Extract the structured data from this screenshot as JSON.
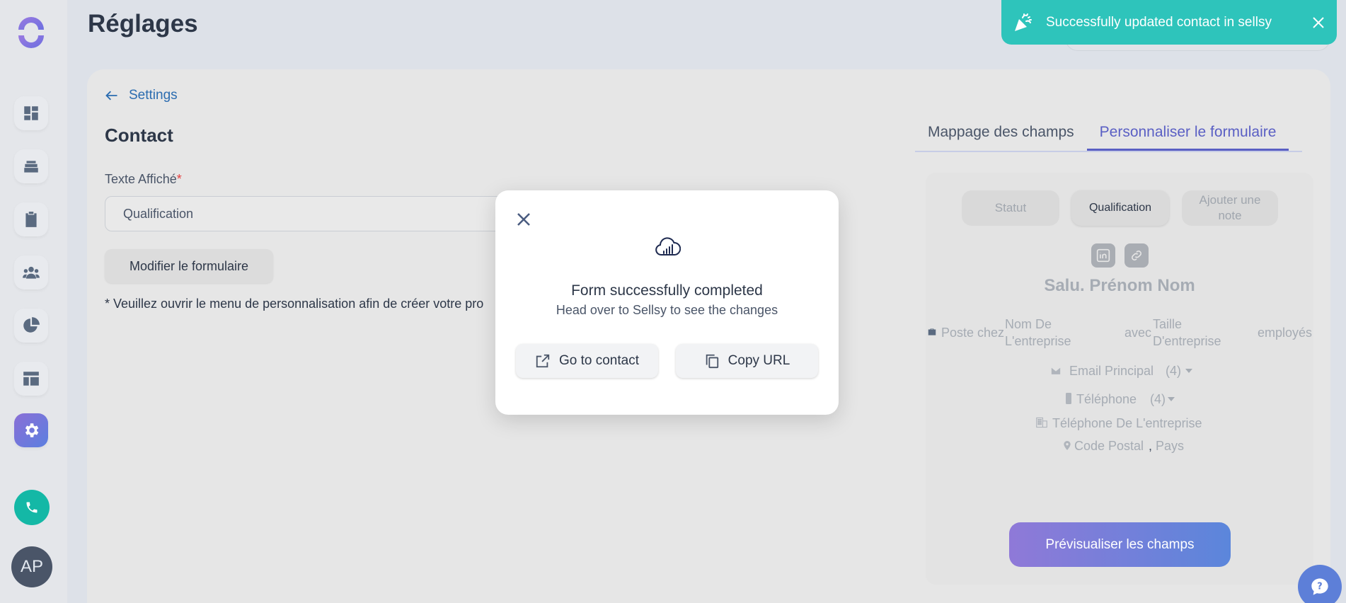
{
  "page": {
    "title": "Réglages"
  },
  "sidebar": {
    "items": [
      {
        "icon": "dashboard-icon"
      },
      {
        "icon": "stack-icon"
      },
      {
        "icon": "clipboard-icon"
      },
      {
        "icon": "users-icon"
      },
      {
        "icon": "pie-chart-icon"
      },
      {
        "icon": "layout-icon"
      },
      {
        "icon": "gear-icon",
        "active": true
      }
    ],
    "avatar_initials": "AP"
  },
  "breadcrumb": {
    "back_label": "Settings"
  },
  "form": {
    "section_title": "Contact",
    "field_label": "Texte Affiché",
    "required_mark": "*",
    "field_value": "Qualification",
    "modify_button": "Modifier le formulaire",
    "helper_text": "* Veuillez ouvrir le menu de personnalisation afin de créer votre pro"
  },
  "tabs": [
    {
      "label": "Mappage des champs",
      "active": false
    },
    {
      "label": "Personnaliser le formulaire",
      "active": true
    }
  ],
  "preview": {
    "pills": [
      "Statut",
      "Qualification",
      "Ajouter une note"
    ],
    "name": "Salu. Prénom Nom",
    "job_line": {
      "poste": "Poste chez",
      "company": "Nom De L'entreprise",
      "with": "avec",
      "size": "Taille D'entreprise",
      "employees": "employés"
    },
    "email": "Email Principal",
    "email_count": "(4)",
    "phone": "Téléphone",
    "phone_count": "(4)",
    "company_phone": "Téléphone De L'entreprise",
    "postal": "Code Postal",
    "comma": ",",
    "country": "Pays",
    "preview_button": "Prévisualiser les champs"
  },
  "modal": {
    "title": "Form successfully completed",
    "subtitle": "Head over to Sellsy to see the changes",
    "go_to_contact": "Go to contact",
    "copy_url": "Copy URL"
  },
  "toast": {
    "message": "Successfully updated contact in sellsy",
    "color": "#2ec4bb"
  },
  "colors": {
    "accent": "#5a5fc4",
    "link": "#2b6cb0",
    "teal": "#14b8a6"
  }
}
